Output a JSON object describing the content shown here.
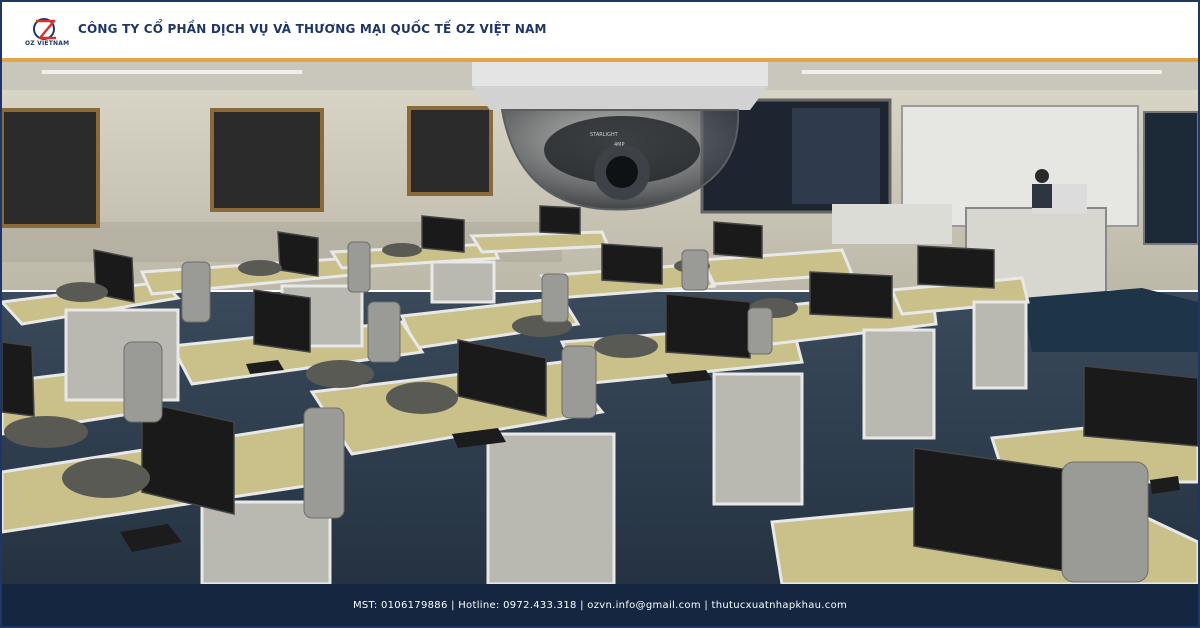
{
  "header": {
    "logo_label": "OZ VIETNAM",
    "company_name": "CÔNG TY CỔ PHẦN DỊCH VỤ VÀ THƯƠNG MẠI QUỐC TẾ OZ VIỆT NAM"
  },
  "photo": {
    "camera_label_1": "STARLIGHT",
    "camera_label_2": "4MP"
  },
  "footer": {
    "contact_line": "MST: 0106179886  |  Hotline: 0972.433.318  |  ozvn.info@gmail.com  |  thutucxuatnhapkhau.com"
  },
  "colors": {
    "brand_navy": "#1f3566",
    "accent_orange": "#e3a547",
    "brand_red": "#d6312b",
    "footer_bg": "#142640"
  }
}
